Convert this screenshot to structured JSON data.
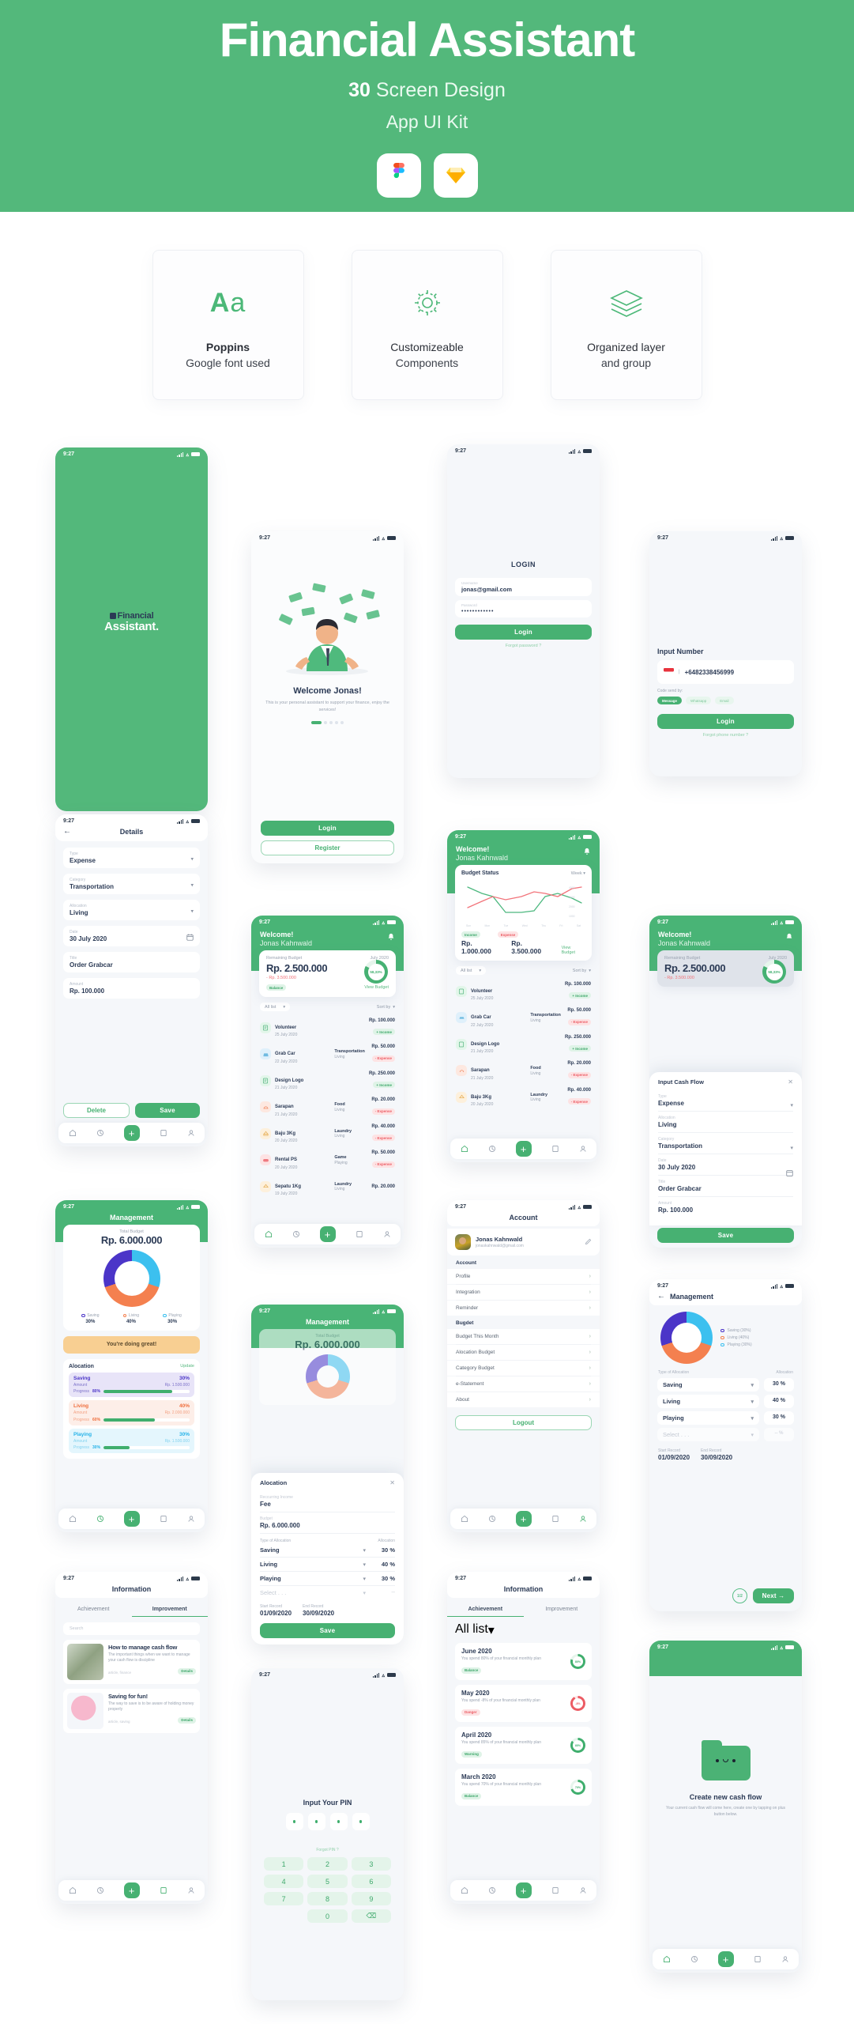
{
  "hero": {
    "title": "Financial Assistant",
    "subtitle_bold": "30",
    "subtitle_rest": " Screen Design",
    "subtitle2": "App UI Kit",
    "icons": [
      "figma-icon",
      "sketch-icon"
    ],
    "bg_color": "#53b87b"
  },
  "features": [
    {
      "icon": "aa-type-icon",
      "glyph": "Aa",
      "title": "Poppins",
      "subtitle": "Google font used",
      "bold": true
    },
    {
      "icon": "gear-icon",
      "title": "Customizeable",
      "subtitle": "Components",
      "bold": false
    },
    {
      "icon": "layers-icon",
      "title": "Organized layer",
      "subtitle": "and group",
      "bold": false
    }
  ],
  "status_bar": {
    "time": "9:27"
  },
  "colors": {
    "brand_green": "#47b172",
    "header_green": "#49b476",
    "navy": "#2b3a55",
    "saving_purple": "#4b35c8",
    "living_orange": "#f4804f",
    "playing_blue": "#3cc0ef",
    "danger_red": "#ec5b63"
  },
  "screens": {
    "splash": {
      "logo_line1": "Financial",
      "logo_line2": "Assistant."
    },
    "welcome": {
      "title": "Welcome Jonas!",
      "desc": "This is your personal assistant to support your finance, enjoy the services!",
      "login": "Login",
      "register": "Register",
      "dots": 5
    },
    "login": {
      "title": "LOGIN",
      "username_label": "Username",
      "username_value": "jonas@gmail.com",
      "password_label": "Password",
      "password_value": "••••••••••••",
      "button": "Login",
      "forgot": "Forgot password ?"
    },
    "input_number": {
      "title": "Input Number",
      "phone": "+6482338456999",
      "code_label": "Code send by:",
      "chips": [
        "Message",
        "Whatsapp",
        "Email"
      ],
      "button": "Login",
      "forgot": "Forgot phone number ?"
    },
    "details": {
      "title": "Details",
      "fields": [
        {
          "label": "Type",
          "value": "Expense",
          "control": "chevron-down-icon"
        },
        {
          "label": "Category",
          "value": "Transportation",
          "control": "chevron-down-icon"
        },
        {
          "label": "Allocation",
          "value": "Living",
          "control": "chevron-down-icon"
        },
        {
          "label": "Date",
          "value": "30 July 2020",
          "control": "calendar-icon"
        },
        {
          "label": "Title",
          "value": "Order Grabcar",
          "control": ""
        },
        {
          "label": "Amount",
          "value": "Rp. 100.000",
          "control": ""
        }
      ],
      "delete": "Delete",
      "save": "Save"
    },
    "dashboard": {
      "welcome": "Welcome!",
      "name": "Jonas Kahnwald",
      "budget_label": "Remaining Budget",
      "budget_month": "July 2020",
      "budget_amount": "Rp. 2.500.000",
      "budget_spent": "- Rp. 3.500.000",
      "ring_pct": "58,33%",
      "badge": "Balance",
      "view_link": "View Budget",
      "filter": "All list",
      "sort": "Sort by",
      "transactions": [
        {
          "icon": "income-icon",
          "name": "Volunteer",
          "date": "25 July 2020",
          "category": "",
          "allocation": "",
          "amount": "Rp. 100.000",
          "tag": "+ Income",
          "tag_type": "green"
        },
        {
          "icon": "car-icon",
          "name": "Grab Car",
          "date": "22 July 2020",
          "category": "Transportation",
          "allocation": "Living",
          "amount": "Rp. 50.000",
          "tag": "- Expense",
          "tag_type": "red"
        },
        {
          "icon": "income-icon",
          "name": "Design Logo",
          "date": "21 July 2020",
          "category": "",
          "allocation": "",
          "amount": "Rp. 250.000",
          "tag": "+ Income",
          "tag_type": "green"
        },
        {
          "icon": "food-icon",
          "name": "Sarapan",
          "date": "21 July 2020",
          "category": "Food",
          "allocation": "Living",
          "amount": "Rp. 20.000",
          "tag": "- Expense",
          "tag_type": "red"
        },
        {
          "icon": "laundry-icon",
          "name": "Baju 3Kg",
          "date": "20 July 2020",
          "category": "Laundry",
          "allocation": "Living",
          "amount": "Rp. 40.000",
          "tag": "- Expense",
          "tag_type": "red"
        },
        {
          "icon": "game-icon",
          "name": "Rental PS",
          "date": "20 July 2020",
          "category": "Game",
          "allocation": "Playing",
          "amount": "Rp. 50.000",
          "tag": "- Expense",
          "tag_type": "red"
        },
        {
          "icon": "laundry-icon",
          "name": "Sepatu 1Kg",
          "date": "19 July 2020",
          "category": "Laundry",
          "allocation": "Living",
          "amount": "Rp. 20.000",
          "tag": "- Expense",
          "tag_type": "red"
        }
      ]
    },
    "budget_status": {
      "welcome": "Welcome!",
      "name": "Jonas Kahnwald",
      "card_title": "Budget Status",
      "period": "Week",
      "income_badge": "Income",
      "expense_badge": "Expense",
      "income_value": "Rp. 1.000.000",
      "expense_value": "Rp. 3.500.000",
      "view_link": "View Budget"
    },
    "input_cash_flow": {
      "title": "Input Cash Flow",
      "close": "close-icon",
      "fields": [
        {
          "label": "Type",
          "value": "Expense",
          "control": "chevron-down-icon"
        },
        {
          "label": "Allocation",
          "value": "Living",
          "control": ""
        },
        {
          "label": "Category",
          "value": "Transportation",
          "control": "chevron-down-icon"
        },
        {
          "label": "Date",
          "value": "30 July 2020",
          "control": "calendar-icon"
        },
        {
          "label": "Title",
          "value": "Order Grabcar",
          "control": ""
        },
        {
          "label": "Amount",
          "value": "Rp. 100.000",
          "control": ""
        }
      ],
      "save": "Save"
    },
    "management": {
      "title": "Management",
      "total_label": "Total Budget",
      "total_value": "Rp. 6.000.000",
      "banner": "You're doing great!",
      "legend": [
        {
          "name": "Saving",
          "pct": "30%",
          "color": "#4b35c8"
        },
        {
          "name": "Living",
          "pct": "40%",
          "color": "#f4804f"
        },
        {
          "name": "Playing",
          "pct": "30%",
          "color": "#3cc0ef"
        }
      ],
      "alloc_title": "Alocation",
      "update": "Update",
      "rows": [
        {
          "name": "Saving",
          "pct": "30%",
          "amount_label": "Amount",
          "amount": "Rp. 1.500.000",
          "progress_label": "Progress",
          "progress": "80%",
          "progress_num": 80,
          "color": "#4b35c8",
          "bg": "#e8e4f8"
        },
        {
          "name": "Living",
          "pct": "40%",
          "amount_label": "Amount",
          "amount": "Rp. 2.000.000",
          "progress_label": "Progress",
          "progress": "60%",
          "progress_num": 60,
          "color": "#f4804f",
          "bg": "#fdeee8"
        },
        {
          "name": "Playing",
          "pct": "30%",
          "amount_label": "Amount",
          "amount": "Rp. 1.500.000",
          "progress_label": "Progress",
          "progress": "30%",
          "progress_num": 30,
          "color": "#3cc0ef",
          "bg": "#e4f6fd"
        }
      ]
    },
    "management_modal": {
      "title": "Management",
      "total_label": "Total Budget",
      "total_value": "Rp. 6.000.000",
      "alloc_title": "Alocation",
      "recurring_label": "Reccurring Income",
      "recurring_value": "Fee",
      "budget_label": "Budget",
      "budget_value": "Rp. 6.000.000",
      "type_label": "Type of Allocation",
      "alloc_label": "Allocation",
      "rows": [
        {
          "name": "Saving",
          "pct": "30 %"
        },
        {
          "name": "Living",
          "pct": "40 %"
        },
        {
          "name": "Playing",
          "pct": "30 %"
        }
      ],
      "select_placeholder": "Select . . .",
      "start_label": "Start Record",
      "start_value": "01/09/2020",
      "end_label": "End Record",
      "end_value": "30/09/2020",
      "save": "Save"
    },
    "management_alloc": {
      "title": "Management",
      "legend": [
        {
          "name": "Saving (30%)",
          "color": "#4b35c8"
        },
        {
          "name": "Living (40%)",
          "color": "#f4804f"
        },
        {
          "name": "Playing (30%)",
          "color": "#3cc0ef"
        }
      ],
      "type_label": "Type of Allocation",
      "alloc_label": "Allocation",
      "rows": [
        {
          "name": "Saving",
          "pct": "30 %"
        },
        {
          "name": "Living",
          "pct": "40 %"
        },
        {
          "name": "Playing",
          "pct": "30 %"
        }
      ],
      "select_placeholder": "Select . . .",
      "select_pct": "-- %",
      "start_label": "Start Record",
      "start_value": "01/09/2020",
      "end_label": "End Record",
      "end_value": "30/09/2020",
      "next": "Next"
    },
    "account": {
      "title": "Account",
      "name": "Jonas Kahnwald",
      "email": "jonaskahnwald@gmail.com",
      "section1": "Account",
      "items1": [
        "Profile",
        "Integration",
        "Reminder"
      ],
      "section2": "Bugdet",
      "items2": [
        "Budget This Month",
        "Alocation Budget",
        "Category Budget",
        "e-Statement",
        "About"
      ],
      "logout": "Logout"
    },
    "information_improvement": {
      "title": "Information",
      "tabs": [
        "Achievement",
        "Improvement"
      ],
      "active_tab": "Improvement",
      "search_placeholder": "Search",
      "articles": [
        {
          "title": "How to manage cash flow",
          "desc": "The important things when we want to manage your cash flow is discipline",
          "meta": "article, finance",
          "badge": "Details"
        },
        {
          "title": "Saving for fun!",
          "desc": "The way to save is to be aware of holding money properly",
          "meta": "article, saving",
          "badge": "Details"
        }
      ]
    },
    "information_achievement": {
      "title": "Information",
      "tabs": [
        "Achievement",
        "Improvement"
      ],
      "active_tab": "Achievement",
      "filter": "All list",
      "items": [
        {
          "month": "June 2020",
          "desc": "You spend 80% of your financial monthly plan",
          "badge": "Balance",
          "badge_type": "green",
          "pct": "80%",
          "pct_num": 80,
          "color": "#3fae6d"
        },
        {
          "month": "May 2020",
          "desc": "You spend -8% of your financial monthly plan",
          "badge": "Danger",
          "badge_type": "red",
          "pct": "-8%",
          "pct_num": 92,
          "color": "#ec5b63"
        },
        {
          "month": "April 2020",
          "desc": "You spend 85% of your financial monthly plan",
          "badge": "Warning",
          "badge_type": "green",
          "pct": "85%",
          "pct_num": 85,
          "color": "#3fae6d"
        },
        {
          "month": "March 2020",
          "desc": "You spend 70% of your financial monthly plan",
          "badge": "Balance",
          "badge_type": "green",
          "pct": "70%",
          "pct_num": 70,
          "color": "#3fae6d"
        }
      ]
    },
    "pin": {
      "title": "Input Your PIN",
      "forgot": "Forgot PIN ?",
      "keys": [
        "1",
        "2",
        "3",
        "4",
        "5",
        "6",
        "7",
        "8",
        "9",
        "0",
        "backspace-icon"
      ]
    },
    "empty_cashflow": {
      "title": "Create new cash flow",
      "desc": "Your current cash flow will come here, create one by tapping on plus button below."
    }
  },
  "chart_data": {
    "type": "line",
    "title": "Budget Status",
    "period": "Week",
    "x": [
      "Sun",
      "Mon",
      "Tue",
      "Wed",
      "Thu",
      "Fri",
      "Sat"
    ],
    "ylim": [
      0,
      4000
    ],
    "yticks": [
      "1000",
      "2000",
      "3000",
      "4000"
    ],
    "series": [
      {
        "name": "Income",
        "color": "#4db87f",
        "values": [
          3400,
          2500,
          200,
          200,
          300,
          2600,
          1800
        ]
      },
      {
        "name": "Expense",
        "color": "#f2737a",
        "values": [
          1200,
          2400,
          2100,
          2700,
          3100,
          2500,
          3400
        ]
      }
    ],
    "legend_position": "bottom",
    "grid": false
  }
}
